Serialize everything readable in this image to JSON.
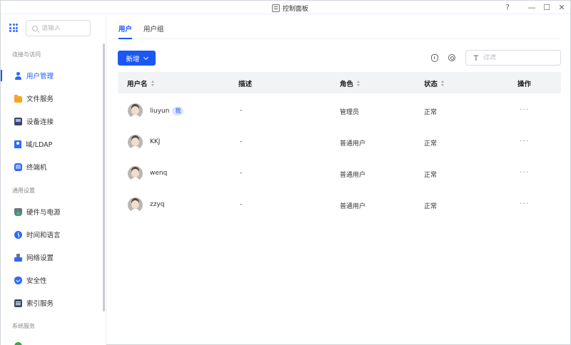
{
  "window": {
    "title": "控制面板",
    "help_label": "?",
    "minimize_label": "—",
    "maximize_label": "☐",
    "close_label": "✕"
  },
  "sidebar": {
    "search_placeholder": "请输入",
    "groups": [
      {
        "label": "连接与访问",
        "items": [
          {
            "label": "用户管理",
            "icon": "user-icon",
            "active": true
          },
          {
            "label": "文件服务",
            "icon": "folder-icon"
          },
          {
            "label": "设备连接",
            "icon": "device-icon"
          },
          {
            "label": "域/LDAP",
            "icon": "ldap-icon"
          },
          {
            "label": "终端机",
            "icon": "terminal-icon"
          }
        ]
      },
      {
        "label": "通用设置",
        "items": [
          {
            "label": "硬件与电源",
            "icon": "hardware-icon"
          },
          {
            "label": "时间和语言",
            "icon": "clock-icon"
          },
          {
            "label": "网络设置",
            "icon": "network-icon"
          },
          {
            "label": "安全性",
            "icon": "shield-icon"
          },
          {
            "label": "索引服务",
            "icon": "index-icon"
          }
        ]
      },
      {
        "label": "系统服务",
        "items": []
      }
    ]
  },
  "main": {
    "tabs": [
      {
        "label": "用户",
        "active": true
      },
      {
        "label": "用户组",
        "active": false
      }
    ],
    "add_button": "新增",
    "filter_placeholder": "过滤",
    "columns": [
      "用户名",
      "描述",
      "角色",
      "状态",
      "操作"
    ],
    "rows": [
      {
        "username": "liuyun",
        "badge": "我",
        "description": "-",
        "role": "管理员",
        "status": "正常",
        "actions": "···"
      },
      {
        "username": "KKJ",
        "badge": "",
        "description": "-",
        "role": "普通用户",
        "status": "正常",
        "actions": "···"
      },
      {
        "username": "wenq",
        "badge": "",
        "description": "-",
        "role": "普通用户",
        "status": "正常",
        "actions": "···"
      },
      {
        "username": "zzyq",
        "badge": "",
        "description": "-",
        "role": "普通用户",
        "status": "正常",
        "actions": "···"
      }
    ]
  },
  "colors": {
    "accent": "#1a57f5",
    "header_bg": "#f2f3f5",
    "badge_bg": "#dbe6ff"
  }
}
